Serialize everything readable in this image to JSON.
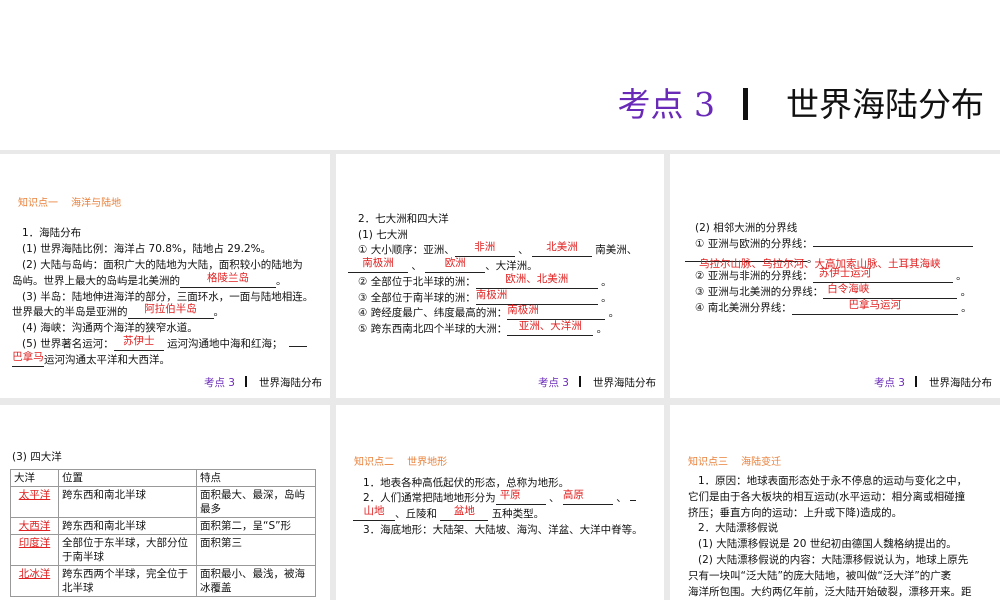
{
  "title": {
    "prefix": "考点 3",
    "main": "世界海陆分布"
  },
  "footer": {
    "prefix": "考点 3",
    "main": "世界海陆分布"
  },
  "p1": {
    "heading": "知识点一　 海洋与陆地",
    "l1": "1．海陆分布",
    "l2": "(1) 世界海陆比例：海洋占 70.8%，陆地占 29.2%。",
    "l3": "(2) 大陆与岛屿：面积广大的陆地为大陆，面积较小的陆地为",
    "l4a": "岛屿。世界上最大的岛屿是北美洲的",
    "a1": "格陵兰岛",
    "l5": "(3) 半岛：陆地伸进海洋的部分，三面环水，一面与陆地相连。",
    "l6a": "世界最大的半岛是亚洲的",
    "a2": "阿拉伯半岛",
    "l7": "(4) 海峡：沟通两个海洋的狭窄水道。",
    "l8a": "(5) 世界著名运河：",
    "a3": "苏伊士",
    "l8b": "运河沟通地中海和红海；",
    "a4": "巴拿马",
    "l9b": "运河沟通太平洋和大西洋。"
  },
  "p2": {
    "l1": "2．七大洲和四大洋",
    "l2": "(1) 七大洲",
    "l3a": "① 大小顺序：亚洲、",
    "a1": "非洲",
    "a2": "北美洲",
    "l3b": "南美洲、",
    "a3": "南极洲",
    "a4": "欧洲",
    "l4b": "、大洋洲。",
    "l5a": "② 全部位于北半球的洲：",
    "a5": "欧洲、北美洲",
    "l6a": "③ 全部位于南半球的洲：",
    "a6": "南极洲",
    "l7a": "④ 跨经度最广、纬度最高的洲：",
    "a7": "南极洲",
    "l8a": "⑤ 跨东西南北四个半球的大洲：",
    "a8": "亚洲、大洋洲"
  },
  "p3": {
    "l1": "(2) 相邻大洲的分界线",
    "l2a": "① 亚洲与欧洲的分界线：",
    "a1": "乌拉尔山脉、乌拉尔河、大高加索山脉、土耳其海峡",
    "l4a": "② 亚洲与非洲的分界线：",
    "a2": "苏伊士运河",
    "l5a": "③ 亚洲与北美洲的分界线：",
    "a3": "白令海峡",
    "l6a": "④ 南北美洲分界线：",
    "a4": "巴拿马运河"
  },
  "p4": {
    "heading": "(3) 四大洋",
    "headers": [
      "大洋",
      "位置",
      "特点"
    ],
    "rows": [
      [
        "太平洋",
        "跨东西和南北半球",
        "面积最大、最深，岛屿最多"
      ],
      [
        "大西洋",
        "跨东西和南北半球",
        "面积第二，呈“S”形"
      ],
      [
        "印度洋",
        "全部位于东半球，大部分位于南半球",
        "面积第三"
      ],
      [
        "北冰洋",
        "跨东西两个半球，完全位于北半球",
        "面积最小、最浅，被海冰覆盖"
      ]
    ]
  },
  "p5": {
    "heading": "知识点二　 世界地形",
    "l1": "1．地表各种高低起伏的形态，总称为地形。",
    "l2a": "2．人们通常把陆地地形分为",
    "a1": "平原",
    "a2": "高原",
    "a3": "山地",
    "l3b": "、丘陵和",
    "a4": "盆地",
    "l3c": "五种类型。",
    "l4": "3．海底地形：大陆架、大陆坡、海沟、洋盆、大洋中脊等。"
  },
  "p6": {
    "heading": "知识点三　 海陆变迁",
    "l1": "1．原因：地球表面形态处于永不停息的运动与变化之中，",
    "l2": "它们是由于各大板块的相互运动(水平运动：相分离或相碰撞",
    "l3": "挤压；垂直方向的运动：上升或下降)造成的。",
    "l4": "2．大陆漂移假说",
    "l5": "(1) 大陆漂移假说是 20 世纪初由德国人魏格纳提出的。",
    "l6": "(2) 大陆漂移假说的内容：大陆漂移假说认为，地球上原先",
    "l7": "只有一块叫“泛大陆”的庞大陆地，被叫做“泛大洋”的广袤",
    "l8": "海洋所包围。大约两亿年前，泛大陆开始破裂，漂移开来。距"
  }
}
